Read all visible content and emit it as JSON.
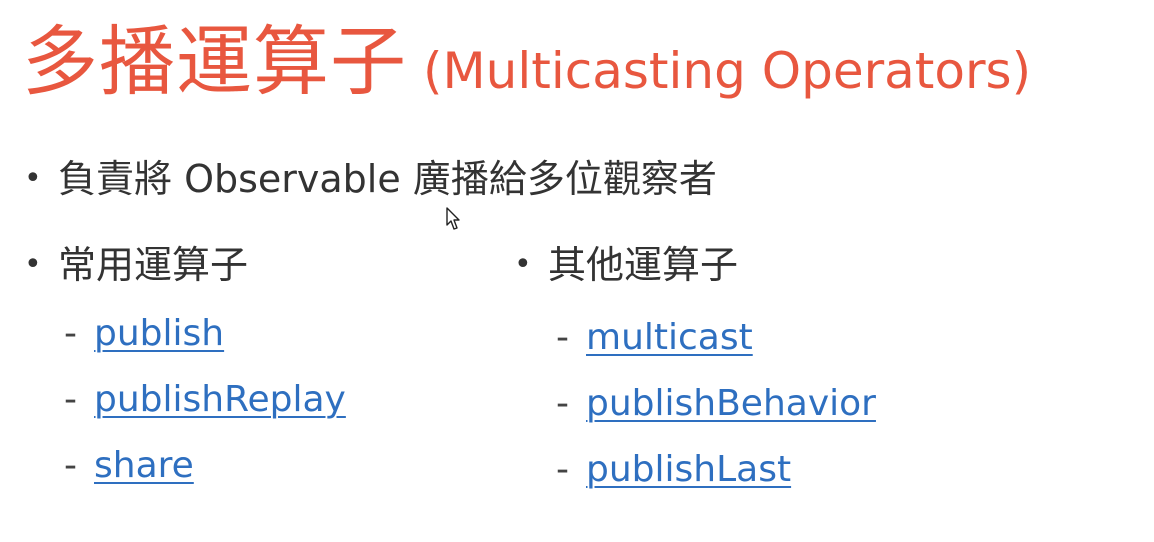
{
  "slide": {
    "title_cjk": "多播運算子",
    "title_en": "(Multicasting Operators)",
    "bullet_main": "負責將 Observable 廣播給多位觀察者",
    "bullet_dot": "•",
    "common": {
      "heading": "常用運算子",
      "items": [
        "publish",
        "publishReplay",
        "share"
      ]
    },
    "other": {
      "heading": "其他運算子",
      "items": [
        "multicast",
        "publishBehavior",
        "publishLast"
      ]
    },
    "dash": "-"
  },
  "colors": {
    "title": "#e8573f",
    "text": "#333333",
    "link": "#2e6fc0"
  },
  "icons": {
    "cursor": "mouse-pointer-icon"
  }
}
